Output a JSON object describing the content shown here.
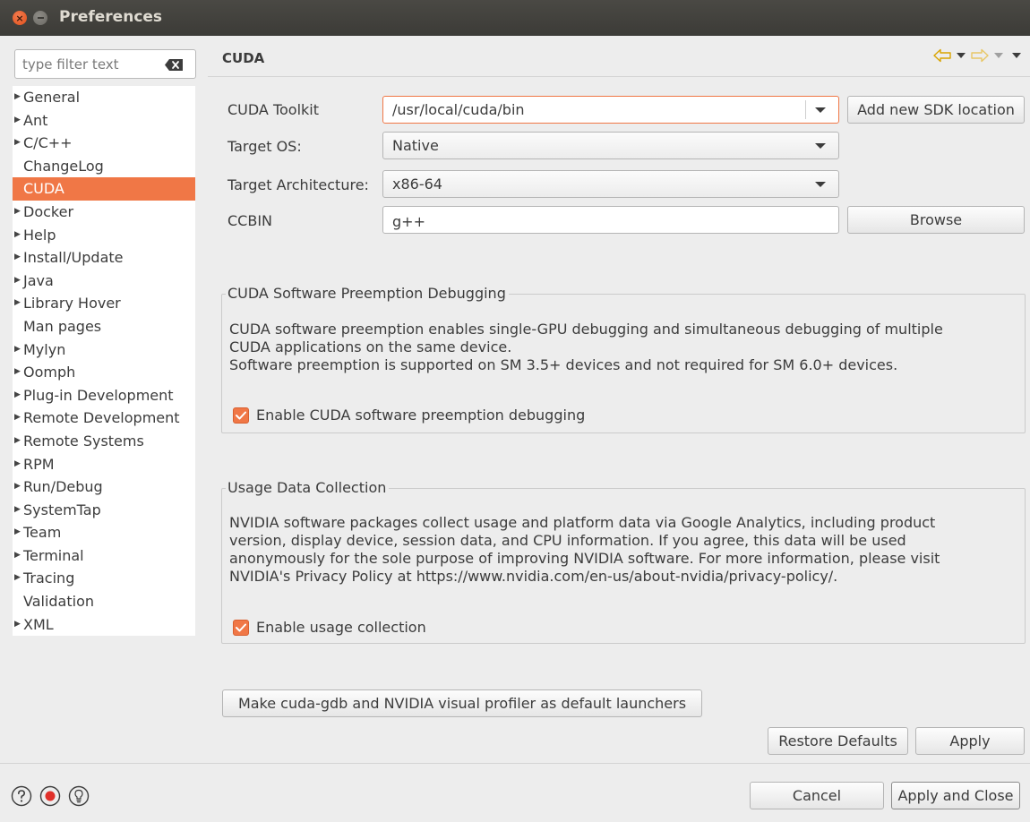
{
  "window": {
    "title": "Preferences"
  },
  "sidebar": {
    "filter_placeholder": "type filter text",
    "items": [
      {
        "label": "General",
        "expandable": true
      },
      {
        "label": "Ant",
        "expandable": true
      },
      {
        "label": "C/C++",
        "expandable": true
      },
      {
        "label": "ChangeLog",
        "expandable": false
      },
      {
        "label": "CUDA",
        "expandable": false,
        "selected": true
      },
      {
        "label": "Docker",
        "expandable": true
      },
      {
        "label": "Help",
        "expandable": true
      },
      {
        "label": "Install/Update",
        "expandable": true
      },
      {
        "label": "Java",
        "expandable": true
      },
      {
        "label": "Library Hover",
        "expandable": true
      },
      {
        "label": "Man pages",
        "expandable": false
      },
      {
        "label": "Mylyn",
        "expandable": true
      },
      {
        "label": "Oomph",
        "expandable": true
      },
      {
        "label": "Plug-in Development",
        "expandable": true
      },
      {
        "label": "Remote Development",
        "expandable": true
      },
      {
        "label": "Remote Systems",
        "expandable": true
      },
      {
        "label": "RPM",
        "expandable": true
      },
      {
        "label": "Run/Debug",
        "expandable": true
      },
      {
        "label": "SystemTap",
        "expandable": true
      },
      {
        "label": "Team",
        "expandable": true
      },
      {
        "label": "Terminal",
        "expandable": true
      },
      {
        "label": "Tracing",
        "expandable": true
      },
      {
        "label": "Validation",
        "expandable": false
      },
      {
        "label": "XML",
        "expandable": true
      }
    ]
  },
  "main": {
    "title": "CUDA",
    "form": {
      "toolkit_label": "CUDA Toolkit",
      "toolkit_value": "/usr/local/cuda/bin",
      "add_sdk_label": "Add new SDK location",
      "target_os_label": "Target OS:",
      "target_os_value": "Native",
      "target_arch_label": "Target Architecture:",
      "target_arch_value": "x86-64",
      "ccbin_label": "CCBIN",
      "ccbin_value": "g++",
      "browse_label": "Browse"
    },
    "preemption": {
      "legend": "CUDA Software Preemption Debugging",
      "lines": [
        "CUDA software preemption enables single-GPU debugging and simultaneous debugging of multiple",
        "CUDA applications on the same device.",
        "Software preemption is supported on SM 3.5+  devices and not required for SM 6.0+ devices."
      ],
      "checkbox_label": "Enable CUDA software preemption debugging",
      "checked": true
    },
    "usage": {
      "legend": "Usage Data Collection",
      "lines": [
        "NVIDIA software packages collect usage and platform data via Google Analytics, including product",
        "version, display device, session data, and CPU information. If you agree, this data will be used",
        "anonymously for the sole purpose of improving NVIDIA software. For more information, please visit",
        "NVIDIA's Privacy Policy at https://www.nvidia.com/en-us/about-nvidia/privacy-policy/."
      ],
      "checkbox_label": "Enable usage collection",
      "checked": true
    },
    "launchers_label": "Make cuda-gdb and NVIDIA visual profiler as default launchers",
    "restore_defaults_label": "Restore Defaults",
    "apply_label": "Apply"
  },
  "footer": {
    "cancel_label": "Cancel",
    "apply_close_label": "Apply and Close",
    "icons": [
      "help-icon",
      "record-icon",
      "tip-icon"
    ]
  },
  "colors": {
    "accent": "#f07746",
    "titlebar": "#3c3b37",
    "background": "#ededed"
  }
}
